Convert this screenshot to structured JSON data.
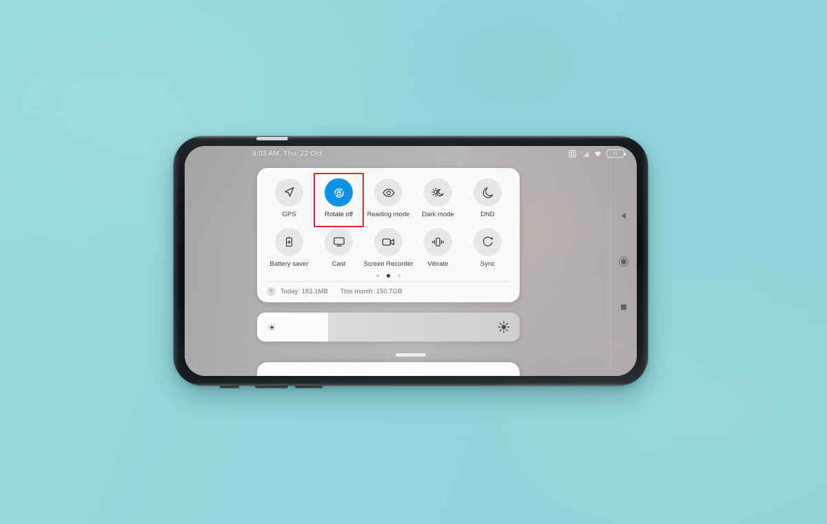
{
  "scene": {
    "background_color": "#93d8de",
    "device_label": "smartphone-landscape"
  },
  "status_bar": {
    "clock": "9:03 AM, Thu, 22 Oct",
    "battery_level": "51",
    "icons": [
      "sim-card-icon",
      "signal-bars-icon",
      "wifi-icon",
      "battery-icon"
    ]
  },
  "quick_settings": {
    "rows": [
      [
        {
          "label": "GPS",
          "icon": "navigation-arrow-icon",
          "active": false
        },
        {
          "label": "Rotate off",
          "icon": "rotation-lock-icon",
          "active": true,
          "highlighted": true
        },
        {
          "label": "Reading mode",
          "icon": "eye-icon",
          "active": false
        },
        {
          "label": "Dark mode",
          "icon": "sun-moon-icon",
          "active": false
        },
        {
          "label": "DND",
          "icon": "moon-icon",
          "active": false
        }
      ],
      [
        {
          "label": "Battery saver",
          "icon": "battery-plus-icon",
          "active": false
        },
        {
          "label": "Cast",
          "icon": "monitor-icon",
          "active": false
        },
        {
          "label": "Screen Recorder",
          "icon": "video-camera-icon",
          "active": false
        },
        {
          "label": "Vibrate",
          "icon": "vibrate-icon",
          "active": false
        },
        {
          "label": "Sync",
          "icon": "sync-circle-icon",
          "active": false
        }
      ]
    ],
    "page_dots": {
      "count": 3,
      "active_index": 1
    },
    "data_usage": {
      "help_glyph": "?",
      "today": "Today: 183.1MB",
      "this_month": "This month: 150.7GB"
    }
  },
  "brightness": {
    "level_percent": 27,
    "low_icon": "brightness-low-icon",
    "high_icon": "brightness-high-icon"
  },
  "navigation_bar": {
    "back": "back-triangle-icon",
    "home": "home-circle-icon",
    "recents": "recents-square-icon"
  },
  "colors": {
    "accent_blue": "#0d93e6",
    "highlight_red": "#e02225",
    "tile_bg": "#e7e7e7",
    "card_bg": "#fafafa",
    "backdrop": "#93d8de"
  }
}
